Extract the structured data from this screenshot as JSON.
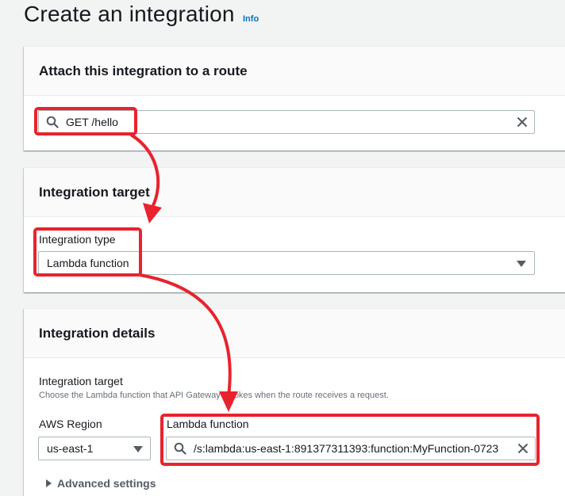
{
  "page": {
    "title": "Create an integration",
    "info_link": "Info"
  },
  "attach_section": {
    "title": "Attach this integration to a route",
    "route_value": "GET /hello"
  },
  "integration_target_section": {
    "title": "Integration target",
    "type_label": "Integration type",
    "type_value": "Lambda function"
  },
  "details_section": {
    "title": "Integration details",
    "target_label": "Integration target",
    "target_description": "Choose the Lambda function that API Gateway invokes when the route receives a request.",
    "region_label": "AWS Region",
    "region_value": "us-east-1",
    "lambda_label": "Lambda function",
    "lambda_value": "/s:lambda:us-east-1:891377311393:function:MyFunction-0723",
    "advanced_label": "Advanced settings"
  },
  "colors": {
    "annotation_red": "#e8232e",
    "link_blue": "#0073bb"
  },
  "icons": [
    "search-icon",
    "clear-icon",
    "caret-down-icon",
    "triangle-right-icon"
  ]
}
